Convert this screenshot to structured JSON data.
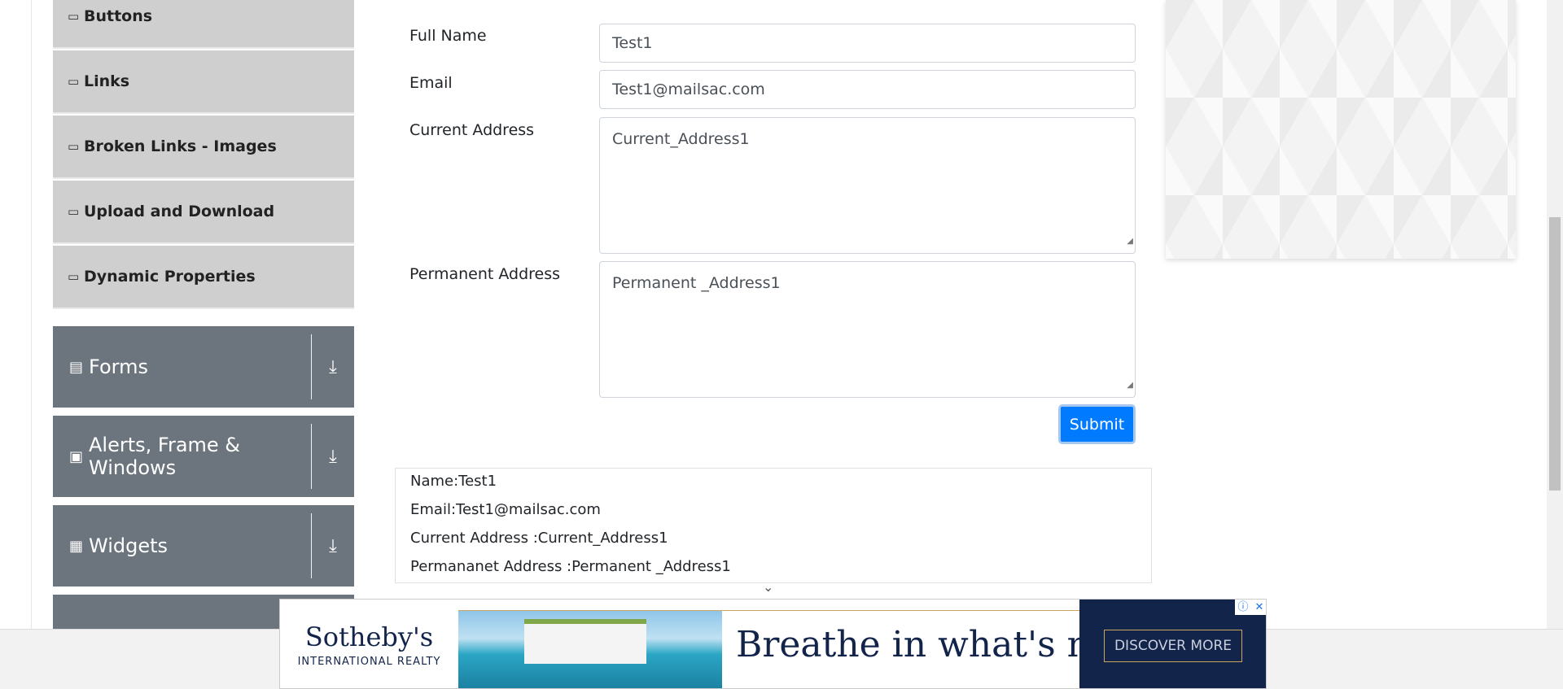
{
  "sidebar": {
    "sub_items": [
      {
        "label": "Buttons"
      },
      {
        "label": "Links"
      },
      {
        "label": "Broken Links - Images"
      },
      {
        "label": "Upload and Download"
      },
      {
        "label": "Dynamic Properties"
      }
    ],
    "groups": [
      {
        "label": "Forms",
        "icon": "document-icon"
      },
      {
        "label": "Alerts, Frame & Windows",
        "icon": "window-icon"
      },
      {
        "label": "Widgets",
        "icon": "grid-icon"
      }
    ]
  },
  "form": {
    "full_name_label": "Full Name",
    "full_name_value": "Test1",
    "email_label": "Email",
    "email_value": "Test1@mailsac.com",
    "current_address_label": "Current Address",
    "current_address_value": "Current_Address1",
    "permanent_address_label": "Permanent Address",
    "permanent_address_value": "Permanent _Address1",
    "submit_label": "Submit"
  },
  "output": {
    "name": "Name:Test1",
    "email": "Email:Test1@mailsac.com",
    "current_address": "Current Address :Current_Address1",
    "permanent_address": "Permananet Address :Permanent _Address1"
  },
  "ad": {
    "brand_name": "Sotheby's",
    "brand_sub": "INTERNATIONAL REALTY",
    "tagline": "Breathe in what's next.",
    "cta": "DISCOVER MORE"
  },
  "colors": {
    "primary": "#007bff",
    "sidebar_group": "#6c757d",
    "sidebar_item": "#cfcfcf",
    "ad_navy": "#13244b",
    "ad_gold": "#c9a560"
  }
}
